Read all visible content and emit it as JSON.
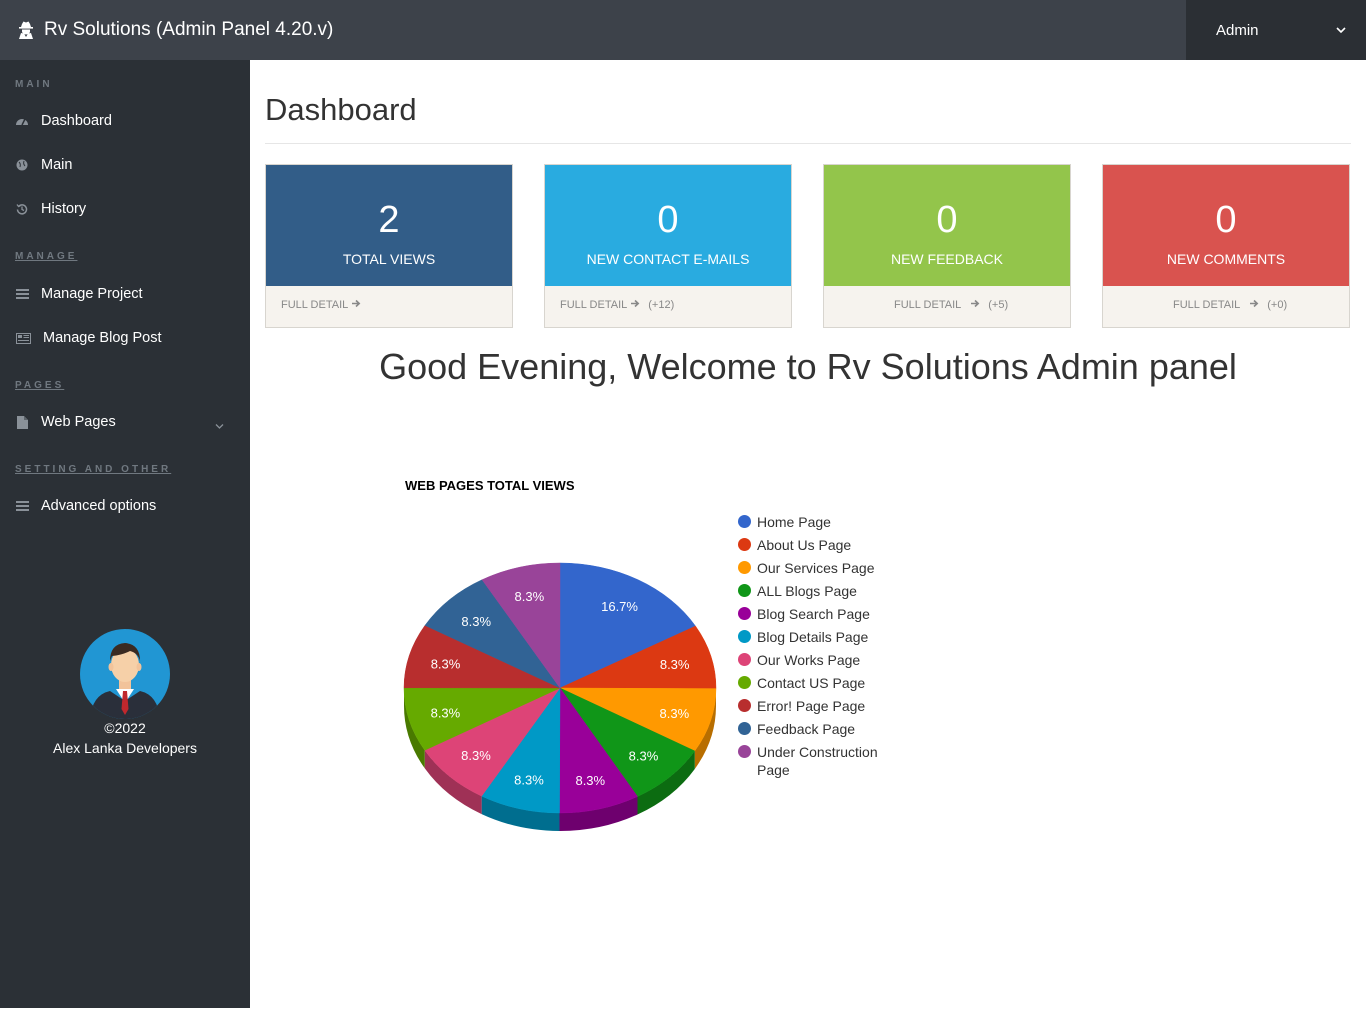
{
  "header": {
    "app_title": "Rv Solutions (Admin Panel 4.20.v)",
    "user": "Admin",
    "logo_icon": "user-secret-icon",
    "menu_icon": "chevron-down-icon"
  },
  "sidebar": {
    "sections": {
      "main": "MAIN",
      "manage": "MANAGE",
      "pages": "PAGES",
      "settings": "SETTING AND OTHER"
    },
    "items": [
      {
        "label": "Dashboard",
        "icon": "dashboard-icon"
      },
      {
        "label": "Main",
        "icon": "globe-icon"
      },
      {
        "label": "History",
        "icon": "history-icon"
      },
      {
        "label": "Manage Project",
        "icon": "list-icon"
      },
      {
        "label": "Manage Blog Post",
        "icon": "newspaper-icon"
      },
      {
        "label": "Web Pages",
        "icon": "file-icon"
      },
      {
        "label": "Advanced options",
        "icon": "list-icon"
      }
    ],
    "copyright": "©2022",
    "company": "Alex Lanka Developers"
  },
  "page": {
    "title": "Dashboard",
    "welcome": "Good Evening, Welcome to Rv Solutions Admin panel"
  },
  "cards": [
    {
      "value": "2",
      "label": "TOTAL VIEWS",
      "link": "FULL DETAIL",
      "extra": "",
      "color": "#325d88"
    },
    {
      "value": "0",
      "label": "NEW CONTACT E-MAILS",
      "link": "FULL DETAIL",
      "extra": "(+12)",
      "color": "#29abe0"
    },
    {
      "value": "0",
      "label": "NEW FEEDBACK",
      "link": "FULL DETAIL",
      "extra": "(+5)",
      "color": "#93c54b"
    },
    {
      "value": "0",
      "label": "NEW COMMENTS",
      "link": "FULL DETAIL",
      "extra": "(+0)",
      "color": "#d9534f"
    }
  ],
  "chart_data": {
    "type": "pie",
    "title": "WEB PAGES TOTAL VIEWS",
    "legend_position": "right",
    "three_d": true,
    "slices": [
      {
        "label": "Home Page",
        "value": 16.7,
        "display": "16.7%",
        "color": "#3366cc"
      },
      {
        "label": "About Us Page",
        "value": 8.3,
        "display": "8.3%",
        "color": "#dc3912"
      },
      {
        "label": "Our Services Page",
        "value": 8.3,
        "display": "8.3%",
        "color": "#ff9900"
      },
      {
        "label": "ALL Blogs Page",
        "value": 8.3,
        "display": "8.3%",
        "color": "#109618"
      },
      {
        "label": "Blog Search Page",
        "value": 8.3,
        "display": "8.3%",
        "color": "#990099"
      },
      {
        "label": "Blog Details Page",
        "value": 8.3,
        "display": "8.3%",
        "color": "#0099c6"
      },
      {
        "label": "Our Works Page",
        "value": 8.3,
        "display": "8.3%",
        "color": "#dd4477"
      },
      {
        "label": "Contact US Page",
        "value": 8.3,
        "display": "8.3%",
        "color": "#66aa00"
      },
      {
        "label": "Error! Page Page",
        "value": 8.3,
        "display": "8.3%",
        "color": "#b82e2e"
      },
      {
        "label": "Feedback Page",
        "value": 8.3,
        "display": "8.3%",
        "color": "#316395"
      },
      {
        "label": "Under Construction Page",
        "value": 8.3,
        "display": "8.3%",
        "color": "#994499"
      }
    ]
  }
}
